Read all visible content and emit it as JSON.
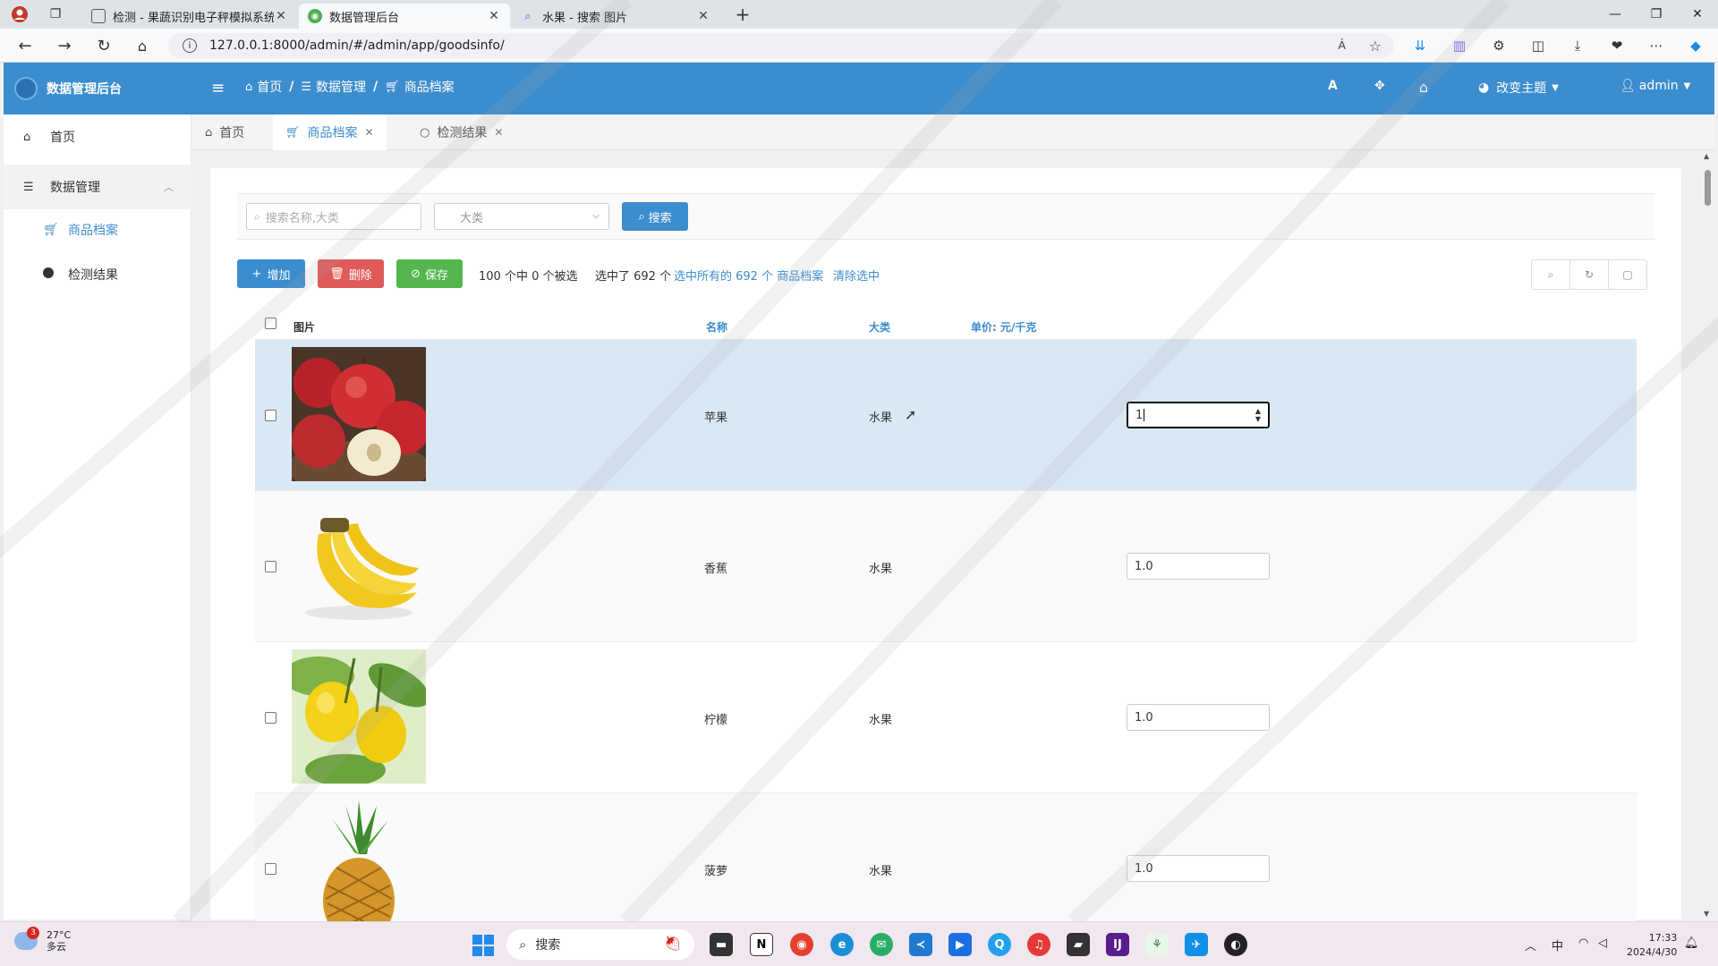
{
  "browser": {
    "tabs": [
      {
        "title": "检测 - 果蔬识别电子秤模拟系统"
      },
      {
        "title": "数据管理后台"
      },
      {
        "title": "水果 - 搜索 图片"
      }
    ],
    "url": "127.0.0.1:8000/admin/#/admin/app/goodsinfo/"
  },
  "app": {
    "brand": "数据管理后台",
    "breadcrumb": [
      "首页",
      "数据管理",
      "商品档案"
    ],
    "theme_label": "改变主题",
    "user": "admin"
  },
  "sidebar": {
    "home": "首页",
    "group": "数据管理",
    "items": [
      "商品档案",
      "检测结果"
    ]
  },
  "page_tabs": [
    {
      "label": "首页"
    },
    {
      "label": "商品档案"
    },
    {
      "label": "检测结果"
    }
  ],
  "filters": {
    "search_placeholder": "搜索名称,大类",
    "category_placeholder": "大类",
    "search_button": "搜索"
  },
  "toolbar": {
    "add": "增加",
    "delete": "删除",
    "save": "保存",
    "selection_info": "100 个中 0 个被选",
    "selected_count": "选中了 692 个",
    "select_all_link": "选中所有的 692 个 商品档案",
    "clear_link": "清除选中"
  },
  "table": {
    "headers": {
      "image": "图片",
      "name": "名称",
      "category": "大类",
      "price": "单价: 元/千克"
    },
    "rows": [
      {
        "name": "苹果",
        "category": "水果",
        "price": "1",
        "image": "apple"
      },
      {
        "name": "香蕉",
        "category": "水果",
        "price": "1.0",
        "image": "banana"
      },
      {
        "name": "柠檬",
        "category": "水果",
        "price": "1.0",
        "image": "lemon"
      },
      {
        "name": "菠萝",
        "category": "水果",
        "price": "1.0",
        "image": "pineapple"
      }
    ]
  },
  "taskbar": {
    "weather_temp": "27°C",
    "weather_desc": "多云",
    "weather_badge": "3",
    "search": "搜索",
    "ime": "中",
    "time": "17:33",
    "date": "2024/4/30"
  },
  "colors": {
    "primary": "#3c8dce",
    "danger": "#e05a5a",
    "success": "#54b64c",
    "selected_row": "#d9e8f5"
  }
}
